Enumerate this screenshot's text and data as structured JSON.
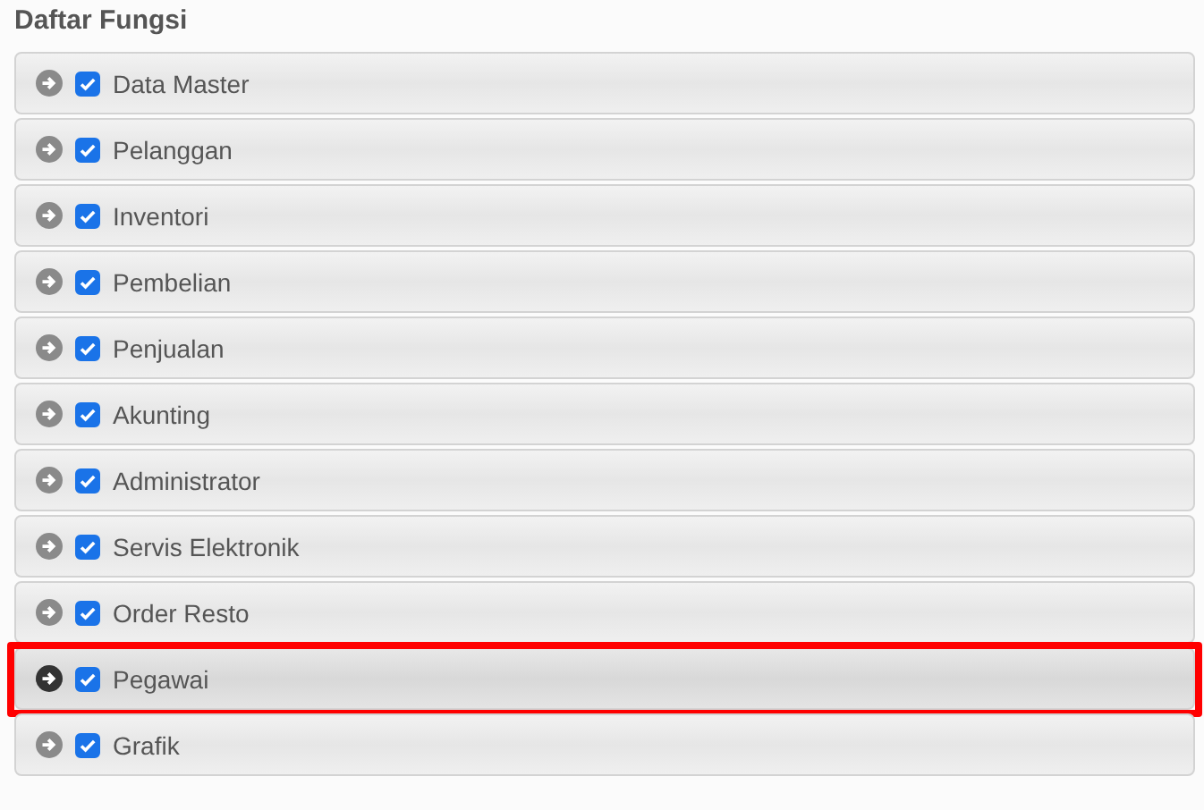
{
  "title": "Daftar Fungsi",
  "items": [
    {
      "label": "Data Master",
      "checked": true,
      "selected": false
    },
    {
      "label": "Pelanggan",
      "checked": true,
      "selected": false
    },
    {
      "label": "Inventori",
      "checked": true,
      "selected": false
    },
    {
      "label": "Pembelian",
      "checked": true,
      "selected": false
    },
    {
      "label": "Penjualan",
      "checked": true,
      "selected": false
    },
    {
      "label": "Akunting",
      "checked": true,
      "selected": false
    },
    {
      "label": "Administrator",
      "checked": true,
      "selected": false
    },
    {
      "label": "Servis Elektronik",
      "checked": true,
      "selected": false
    },
    {
      "label": "Order Resto",
      "checked": true,
      "selected": false
    },
    {
      "label": "Pegawai",
      "checked": true,
      "selected": true
    },
    {
      "label": "Grafik",
      "checked": true,
      "selected": false
    }
  ]
}
